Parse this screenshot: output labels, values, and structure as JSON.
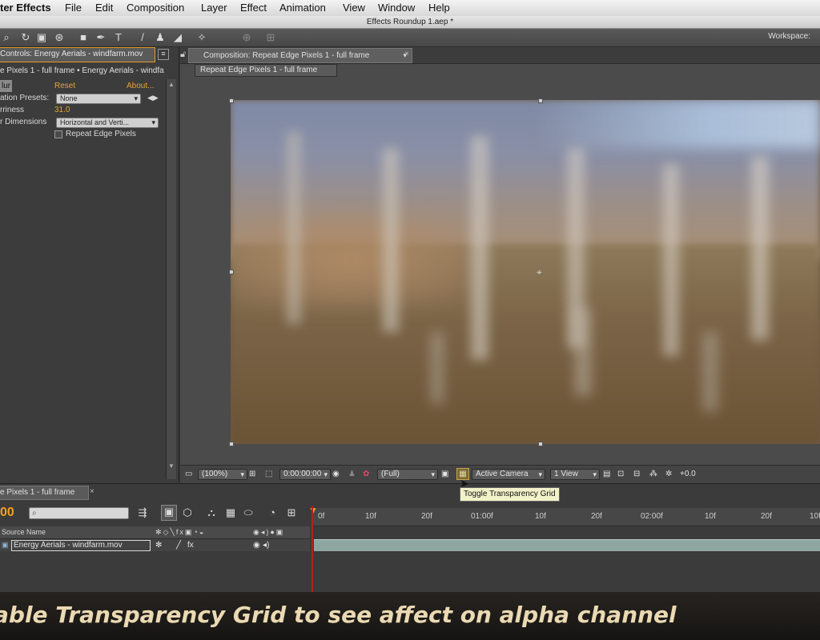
{
  "menubar": {
    "items": [
      "ter Effects",
      "File",
      "Edit",
      "Composition",
      "Layer",
      "Effect",
      "Animation",
      "View",
      "Window",
      "Help"
    ]
  },
  "window_title": "Effects Roundup 1.aep *",
  "toolbar": {
    "workspace_label": "Workspace:"
  },
  "effect_controls": {
    "tab_label": "Controls: Energy Aerials - windfarm.mov",
    "breadcrumb": "e Pixels 1 - full frame • Energy Aerials - windfa",
    "effect_name": "lur",
    "reset_label": "Reset",
    "about_label": "About...",
    "presets_label": "ation Presets:",
    "presets_value": "None",
    "blurriness_label": "rriness",
    "blurriness_value": "31.0",
    "dimensions_label": "r Dimensions",
    "dimensions_value": "Horizontal and Verti...",
    "repeat_edge_label": "Repeat Edge Pixels"
  },
  "composition": {
    "tab_label": "Composition: Repeat Edge Pixels 1 - full frame",
    "sub_tab_label": "Repeat Edge Pixels 1 - full frame",
    "magnification": "(100%)",
    "timecode": "0:00:00:00",
    "resolution": "(Full)",
    "camera": "Active Camera",
    "views": "1 View",
    "exposure": "+0.0",
    "tooltip": "Toggle Transparency Grid"
  },
  "timeline": {
    "tab_label": "e Pixels 1 - full frame",
    "current_time": "00",
    "column_source_name": "Source Name",
    "layer_name": "Energy Aerials - windfarm.mov",
    "ruler_ticks": [
      "0f",
      "10f",
      "20f",
      "01:00f",
      "10f",
      "20f",
      "02:00f",
      "10f",
      "20f",
      "10f"
    ]
  },
  "caption": "able Transparency Grid to see affect on alpha channel"
}
